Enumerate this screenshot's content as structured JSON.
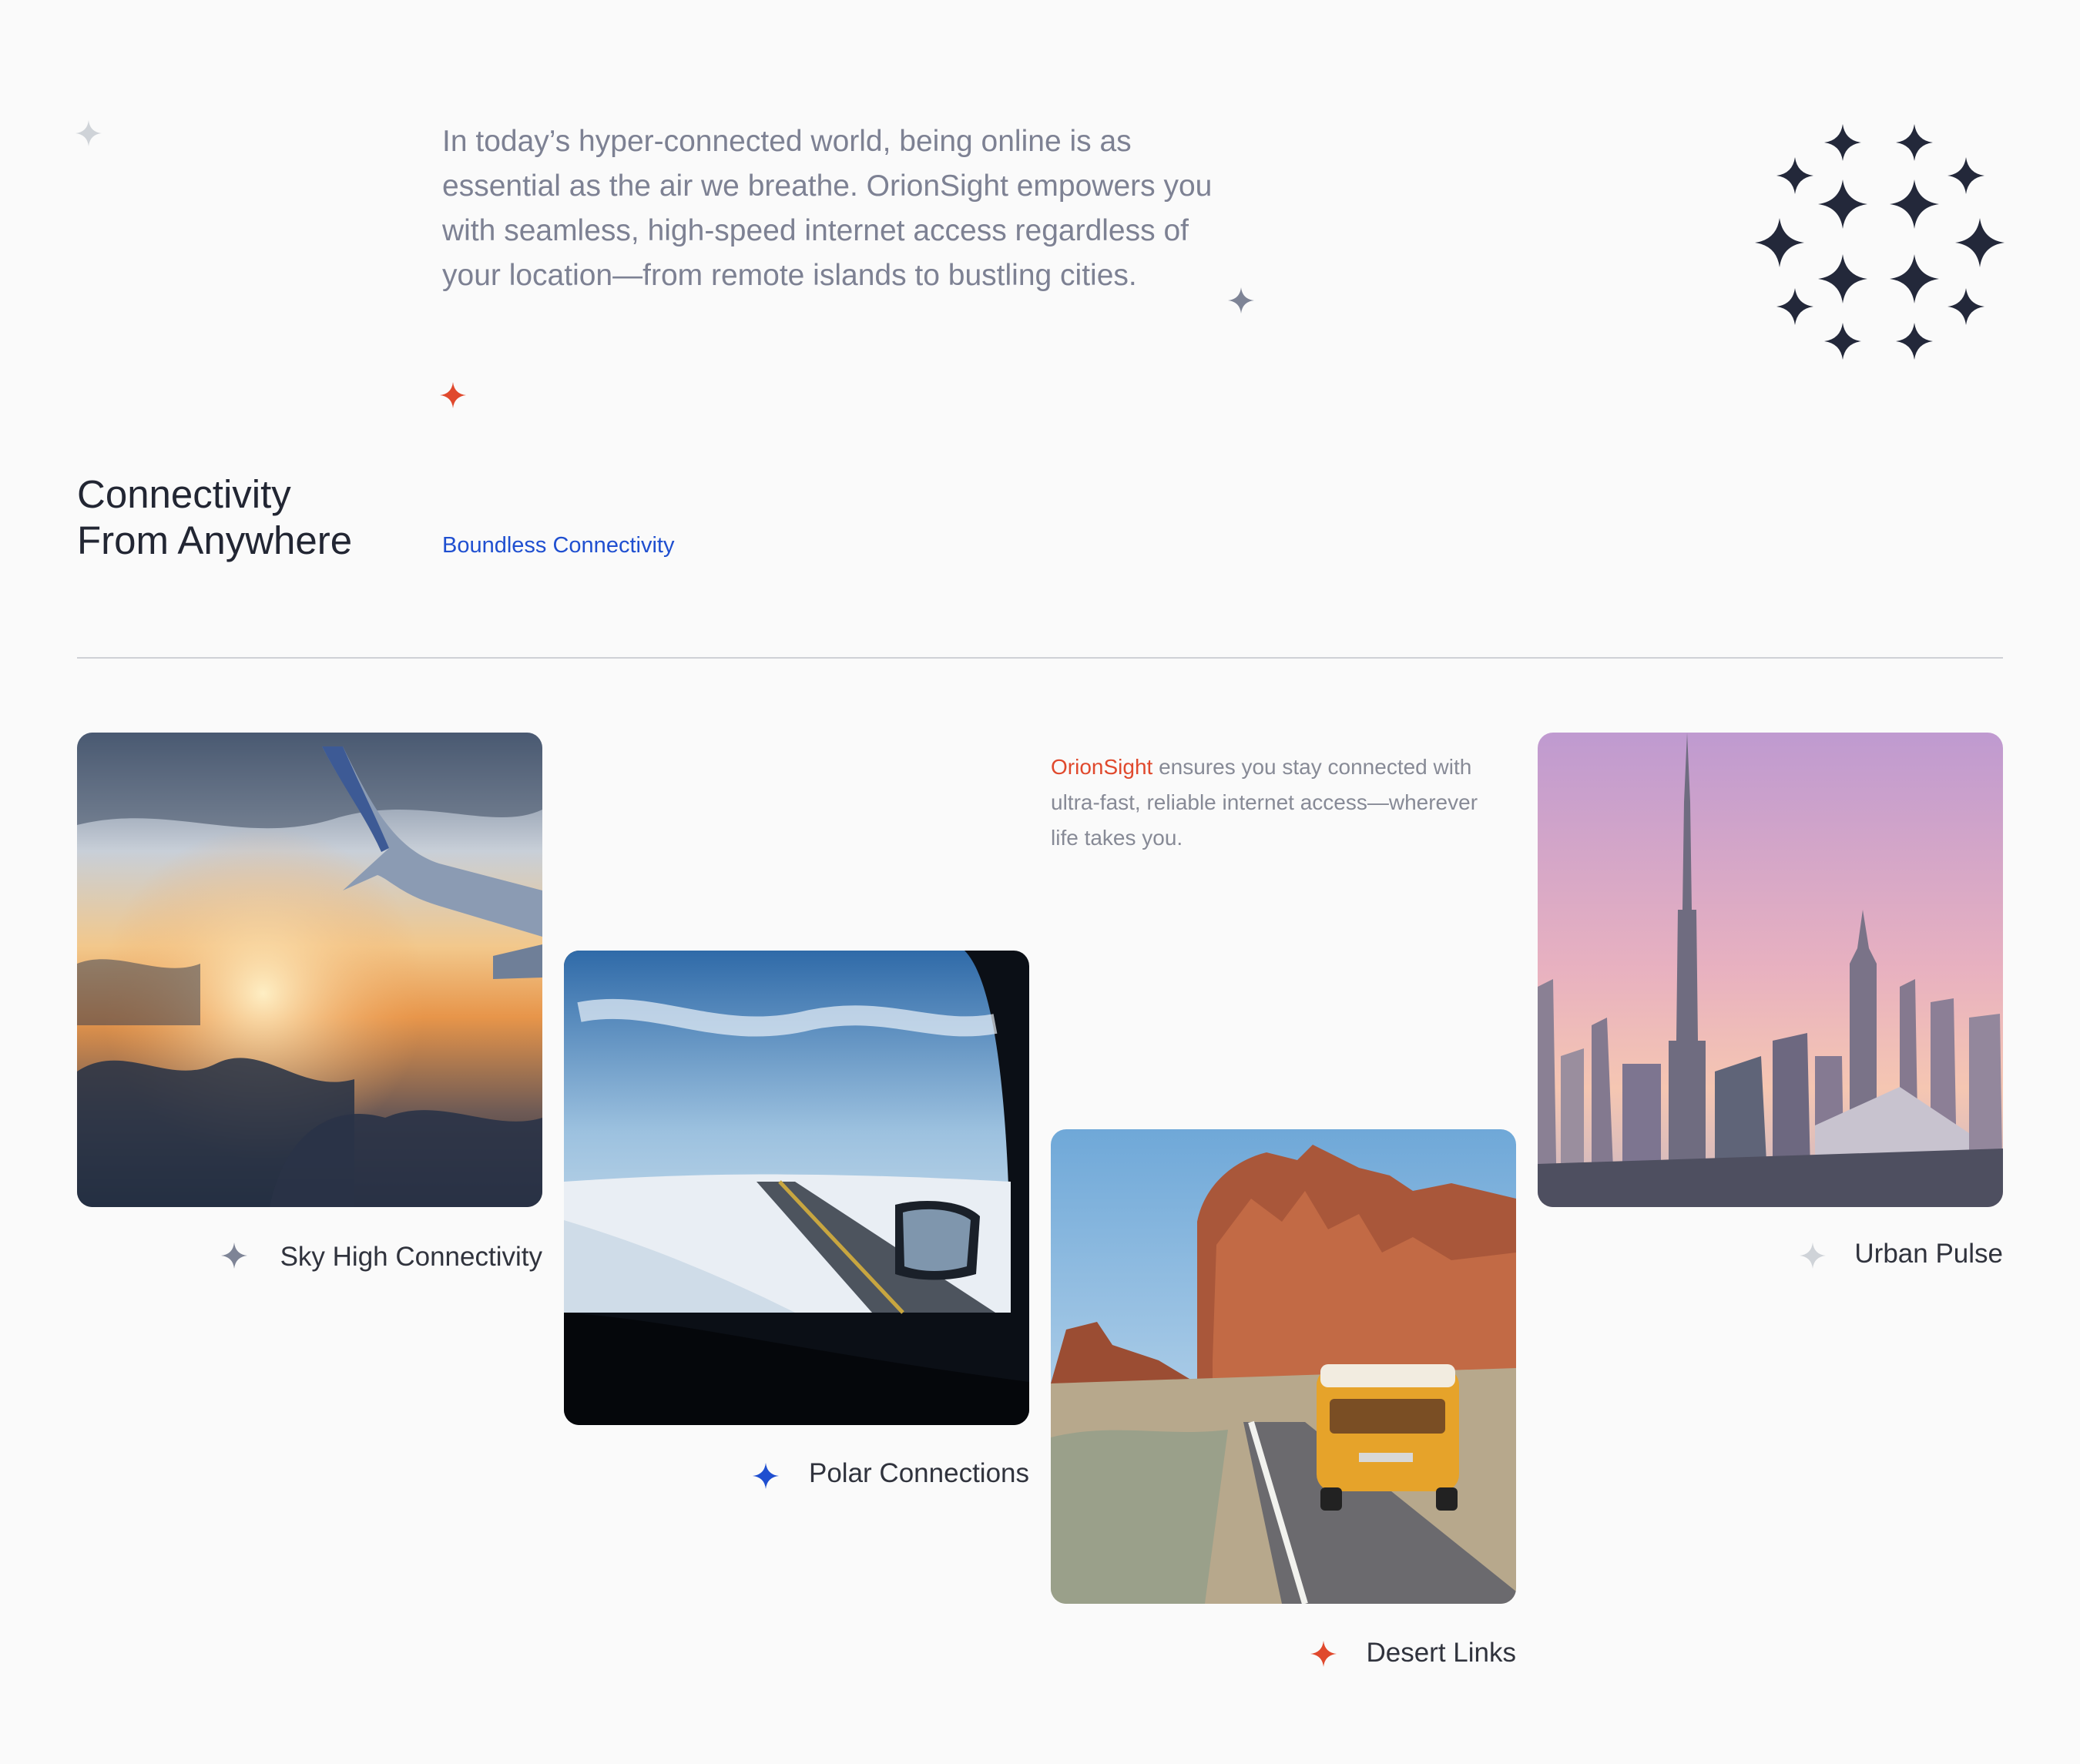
{
  "intro": {
    "text": "In today’s hyper-connected world, being online is as essential as the air we breathe. OrionSight empowers you with seamless, high-speed internet access regardless of your location—from remote islands to bustling cities."
  },
  "section": {
    "title_line1": "Connectivity",
    "title_line2": "From Anywhere",
    "tagline": "Boundless Connectivity"
  },
  "description": {
    "brand": "OrionSight",
    "text": " ensures you stay connected with ultra-fast, reliable internet access—wherever life takes you."
  },
  "cards": [
    {
      "caption": "Sky High Connectivity",
      "image": "airplane-wing-over-clouds-photo",
      "sparkle_color": "#7e8496"
    },
    {
      "caption": "Polar Connections",
      "image": "snowy-road-through-car-window-photo",
      "sparkle_color": "#1f4fd0"
    },
    {
      "caption": "Desert Links",
      "image": "yellow-van-desert-road-photo",
      "sparkle_color": "#e0492d"
    },
    {
      "caption": "Urban Pulse",
      "image": "city-skyline-skyscraper-photo",
      "sparkle_color": "#cfd3d8"
    }
  ],
  "colors": {
    "background": "#fafafa",
    "accent_red": "#e0492d",
    "accent_blue": "#1f4fd0",
    "star_dark": "#23283a",
    "text_gray": "#7d8193"
  }
}
